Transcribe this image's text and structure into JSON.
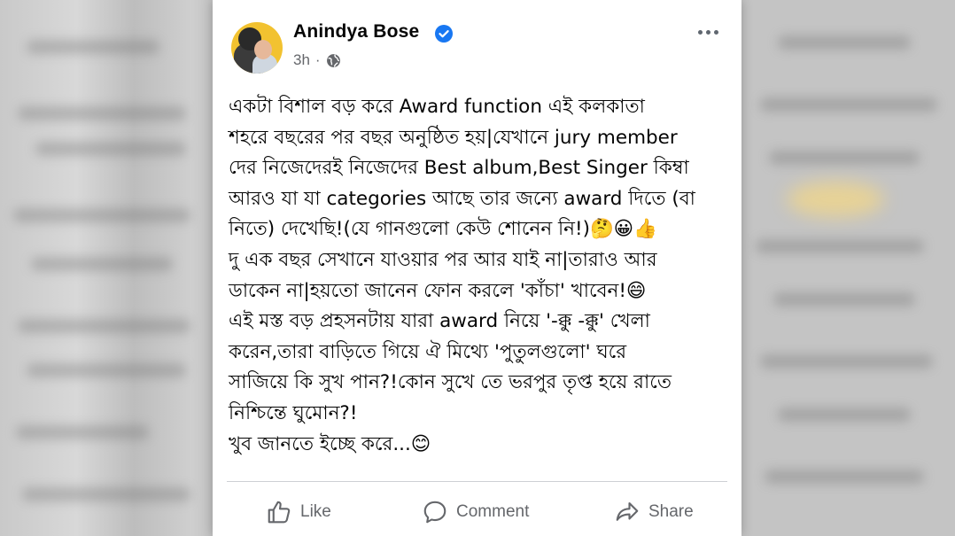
{
  "post": {
    "author": "Anindya Bose",
    "time": "3h",
    "separator": "·",
    "lines": [
      "একটা বিশাল বড় করে Award function এই কলকাতা",
      "শহরে বছরের পর বছর অনুষ্ঠিত হয়|যেখানে jury member",
      "দের নিজেদেরই নিজেদের Best album,Best Singer কিম্বা",
      "আরও যা যা categories আছে তার জন্যে award দিতে (বা",
      "নিতে) দেখেছি!(যে গানগুলো কেউ শোনেন নি!)🤔😀👍",
      "দু এক বছর সেখানে যাওয়ার পর আর যাই না|তারাও আর",
      "ডাকেন না|হয়তো জানেন ফোন করলে 'কাঁচা' খাবেন!😄",
      "এই মস্ত বড় প্রহসনটায় যারা award নিয়ে '-ক্কু -ক্কু' খেলা",
      "করেন,তারা বাড়িতে গিয়ে ঐ মিথ্যে 'পুতুলগুলো' ঘরে",
      "সাজিয়ে কি সুখ পান?!কোন সুখে তে ভরপুর তৃপ্ত হয়ে রাতে",
      "নিশ্চিন্তে ঘুমোন?!",
      "খুব জানতে ইচ্ছে করে...😊"
    ]
  },
  "actions": {
    "like": "Like",
    "comment": "Comment",
    "share": "Share"
  },
  "icons": {
    "verified": "verified-badge-icon",
    "audience": "globe-icon",
    "more": "more-options-icon",
    "like": "thumbs-up-icon",
    "comment": "comment-bubble-icon",
    "share": "share-arrow-icon"
  },
  "colors": {
    "verified": "#1877f2",
    "text": "#050505",
    "secondary": "#65676b",
    "avatar_bg": "#f2c230"
  }
}
